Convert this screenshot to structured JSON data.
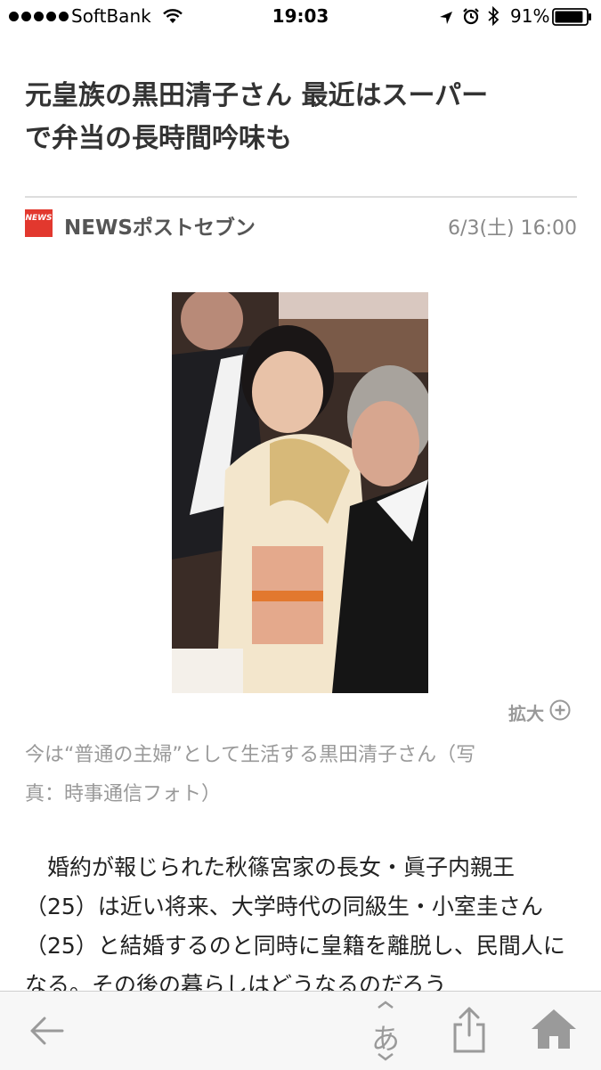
{
  "status_bar": {
    "carrier": "SoftBank",
    "time": "19:03",
    "battery_percent": "91%",
    "battery_level": 0.91,
    "icons": [
      "signal-dots-icon",
      "wifi-icon",
      "location-arrow-icon",
      "alarm-icon",
      "bluetooth-icon",
      "battery-icon"
    ]
  },
  "article": {
    "headline_line1": "元皇族の黒田清子さん 最近はスーパー",
    "headline_line2": "で弁当の長時間吟味も",
    "source": {
      "logo_text": "NEWS",
      "name": "NEWSポストセブン",
      "publish_time": "6/3(土) 16:00"
    },
    "photo": {
      "zoom_label": "拡大"
    },
    "caption_line1": "今は“普通の主婦”として生活する黒田清子さん（写",
    "caption_line2": "真：時事通信フォト）",
    "body": "婚約が報じられた秋篠宮家の長女・眞子内親王（25）は近い将来、大学時代の同級生・小室圭さん（25）と結婚するのと同時に皇籍を離脱し、民間人になる。その後の暮らしはどうなるのだろう"
  },
  "toolbar": {
    "font_glyph": "あ",
    "icons": [
      "back-arrow-icon",
      "font-size-icon",
      "share-icon",
      "home-icon"
    ]
  },
  "colors": {
    "headline": "#333333",
    "caption": "#999999",
    "logo_red": "#e2382e",
    "toolbar_bg": "#f7f7f7",
    "toolbar_icon": "#9a9a9a"
  }
}
